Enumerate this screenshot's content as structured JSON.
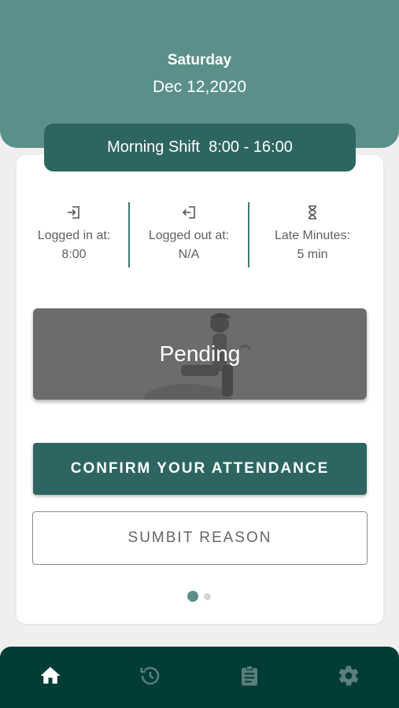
{
  "header": {
    "day": "Saturday",
    "date": "Dec 12,2020"
  },
  "shift": {
    "label": "Morning Shift  8:00 - 16:00"
  },
  "stats": [
    {
      "icon": "login-icon",
      "label": "Logged in at:",
      "value": "8:00"
    },
    {
      "icon": "logout-icon",
      "label": "Logged out at:",
      "value": "N/A"
    },
    {
      "icon": "hourglass-icon",
      "label": "Late Minutes:",
      "value": "5 min"
    }
  ],
  "status": {
    "label": "Pending"
  },
  "actions": {
    "confirm_label": "CONFIRM YOUR ATTENDANCE",
    "reason_label": "SUMBIT REASON"
  },
  "pager": {
    "count": 2,
    "active": 0
  },
  "bottom_nav": [
    {
      "icon": "home-icon",
      "active": true
    },
    {
      "icon": "history-icon",
      "active": false
    },
    {
      "icon": "clipboard-icon",
      "active": false
    },
    {
      "icon": "settings-icon",
      "active": false
    }
  ],
  "colors": {
    "primary": "#2d6561",
    "header": "#5b8f8a",
    "nav": "#003c36",
    "pending": "#6c6c6e"
  }
}
